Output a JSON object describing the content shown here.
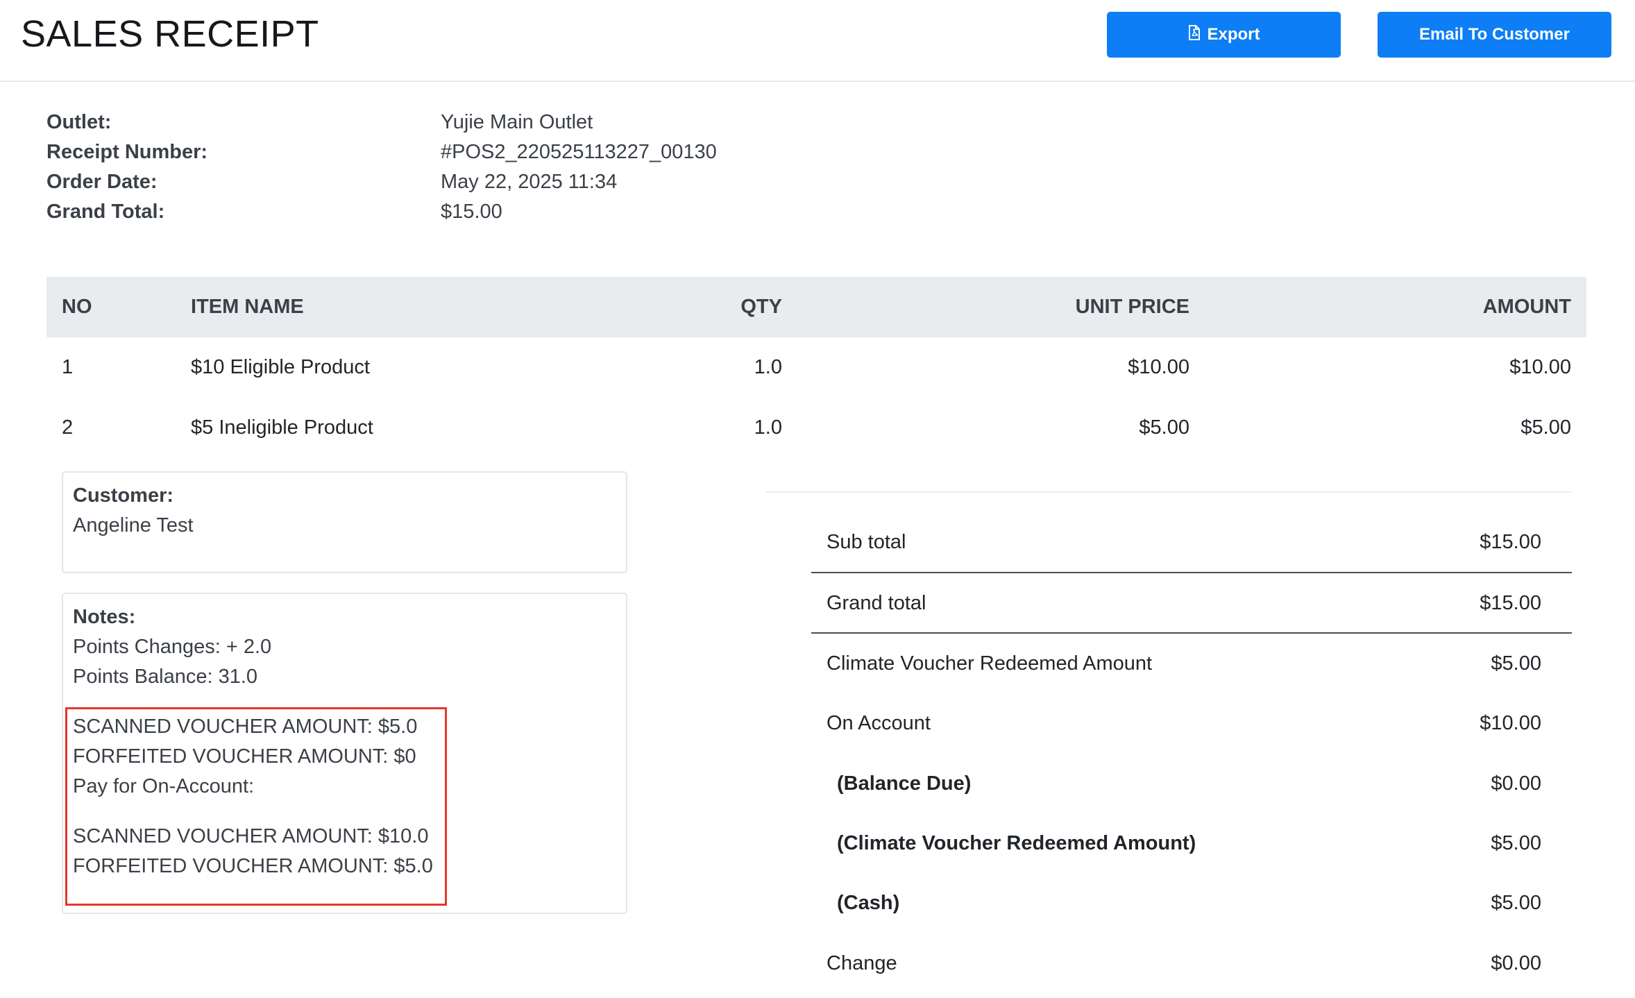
{
  "header": {
    "title": "SALES RECEIPT",
    "export_label": "Export",
    "email_label": "Email To Customer"
  },
  "info": [
    {
      "label": "Outlet:",
      "value": "Yujie Main Outlet"
    },
    {
      "label": "Receipt Number:",
      "value": "#POS2_220525113227_00130"
    },
    {
      "label": "Order Date:",
      "value": "May 22, 2025 11:34"
    },
    {
      "label": "Grand Total:",
      "value": "$15.00"
    }
  ],
  "table": {
    "headers": {
      "no": "NO",
      "name": "ITEM NAME",
      "qty": "QTY",
      "price": "UNIT PRICE",
      "amount": "AMOUNT"
    },
    "rows": [
      {
        "no": "1",
        "name": "$10 Eligible Product",
        "qty": "1.0",
        "price": "$10.00",
        "amount": "$10.00"
      },
      {
        "no": "2",
        "name": "$5 Ineligible Product",
        "qty": "1.0",
        "price": "$5.00",
        "amount": "$5.00"
      }
    ]
  },
  "customer": {
    "label": "Customer:",
    "name": "Angeline Test"
  },
  "notes": {
    "label": "Notes:",
    "points_changes": "Points Changes: + 2.0",
    "points_balance": "Points Balance: 31.0",
    "scanned_1": "SCANNED VOUCHER AMOUNT: $5.0",
    "forfeited_1": "FORFEITED VOUCHER AMOUNT: $0",
    "pay_on_account": "Pay for On-Account:",
    "scanned_2": "SCANNED VOUCHER AMOUNT: $10.0",
    "forfeited_2": "FORFEITED VOUCHER AMOUNT: $5.0"
  },
  "summary": [
    {
      "label": "Sub total",
      "value": "$15.00"
    },
    {
      "label": "Grand total",
      "value": "$15.00"
    },
    {
      "label": "Climate Voucher Redeemed Amount",
      "value": "$5.00"
    },
    {
      "label": "On Account",
      "value": "$10.00"
    },
    {
      "label": "(Balance Due)",
      "value": "$0.00"
    },
    {
      "label": "(Climate Voucher Redeemed Amount)",
      "value": "$5.00"
    },
    {
      "label": "(Cash)",
      "value": "$5.00"
    },
    {
      "label": "Change",
      "value": "$0.00"
    }
  ],
  "colors": {
    "accent": "#0d7ef5",
    "highlight_border": "#e3372a",
    "table_header_bg": "#e9ecef"
  },
  "icons": {
    "export": "pdf-file-icon"
  }
}
